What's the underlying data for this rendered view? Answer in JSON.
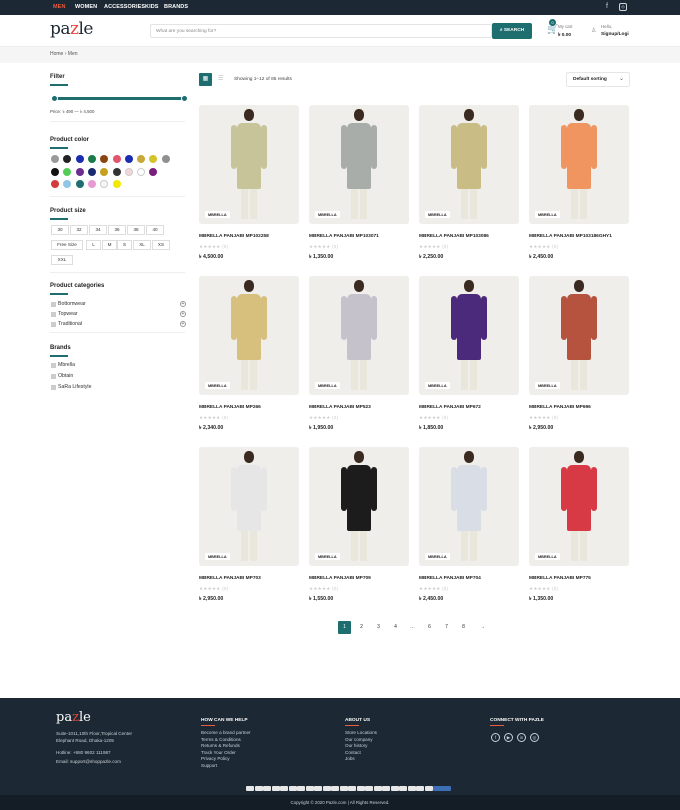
{
  "topbar": {
    "nav": [
      "MEN",
      "WOMEN",
      "ACCESSORIES",
      "KIDS",
      "BRANDS"
    ],
    "active": "MEN"
  },
  "header": {
    "logo_text": "pazle",
    "search_placeholder": "What are you searching for?",
    "search_button": "SEARCH",
    "cart_count": "0",
    "cart_label": "My cart",
    "cart_total": "৳ 0.00",
    "account_greeting": "Hello,",
    "account_link": "Signup/Logi"
  },
  "breadcrumb": {
    "home": "Home",
    "sep": "›",
    "current": "Men"
  },
  "filter": {
    "title": "Filter",
    "price_text": "Price: ৳ 490 — ৳ 4,500",
    "price_min_fraction": 0.0,
    "price_max_fraction": 1.0
  },
  "colors": {
    "title": "Product color",
    "swatches": [
      "#9a9a9a",
      "#222222",
      "#1a2db0",
      "#1a7a4a",
      "#8b4513",
      "#e2556e",
      "#1a2db0",
      "#c8a83a",
      "#d4c32a",
      "#8f8f8f",
      "#111111",
      "#55cc55",
      "#6b2d8f",
      "#1a2a6e",
      "#c6a020",
      "#333333",
      "#f3d6d6",
      "#ffffff",
      "#7a1f7a",
      "#d23c3c",
      "#8fc6e8",
      "#1e6d6f",
      "#e89ad0",
      "#f5f5f5",
      "#f2e800"
    ]
  },
  "sizes": {
    "title": "Product size",
    "items": [
      "30",
      "32",
      "34",
      "36",
      "38",
      "40",
      "Free Size",
      "L",
      "M",
      "S",
      "XL",
      "XS",
      "XXL"
    ]
  },
  "categories": {
    "title": "Product categories",
    "items": [
      "Bottomwear",
      "Topwear",
      "Traditional"
    ]
  },
  "brands": {
    "title": "Brands",
    "items": [
      "Mbrella",
      "Obtain",
      "SaRa Lifestyle"
    ]
  },
  "toolbar": {
    "result_text": "Showing 1–12 of 85 results",
    "sort_label": "Default sorting"
  },
  "products": [
    {
      "name": "MBRELLA PANJABI MP102258",
      "price": "৳ 4,500.00",
      "reviews": "(0)",
      "brand": "MBRELLA",
      "color": "#c8c49a"
    },
    {
      "name": "MBRELLA PANJABI MP103071",
      "price": "৳ 1,350.00",
      "reviews": "(0)",
      "brand": "MBRELLA",
      "color": "#a8adaa"
    },
    {
      "name": "MBRELLA PANJABI MP103086",
      "price": "৳ 2,250.00",
      "reviews": "(0)",
      "brand": "MBRELLA",
      "color": "#c9bd85"
    },
    {
      "name": "MBRELLA PANJABI MP103186GHY1",
      "price": "৳ 2,450.00",
      "reviews": "(0)",
      "brand": "MBRELLA",
      "color": "#f0955f"
    },
    {
      "name": "MBRELLA PANJABI MP266",
      "price": "৳ 2,340.00",
      "reviews": "(0)",
      "brand": "MBRELLA",
      "color": "#d7c07e"
    },
    {
      "name": "MBRELLA PANJABI MP523",
      "price": "৳ 1,950.00",
      "reviews": "(0)",
      "brand": "MBRELLA",
      "color": "#c5c2cc"
    },
    {
      "name": "MBRELLA PANJABI MP672",
      "price": "৳ 1,850.00",
      "reviews": "(0)",
      "brand": "MBRELLA",
      "color": "#4b2a7c"
    },
    {
      "name": "MBRELLA PANJABI MP696",
      "price": "৳ 2,950.00",
      "reviews": "(0)",
      "brand": "MBRELLA",
      "color": "#b5533f"
    },
    {
      "name": "MBRELLA PANJABI MP703",
      "price": "৳ 2,950.00",
      "reviews": "(0)",
      "brand": "MBRELLA",
      "color": "#e6e6e6"
    },
    {
      "name": "MBRELLA PANJABI MP709",
      "price": "৳ 1,550.00",
      "reviews": "(0)",
      "brand": "MBRELLA",
      "color": "#1c1c1c"
    },
    {
      "name": "MBRELLA PANJABI MP704",
      "price": "৳ 2,450.00",
      "reviews": "(0)",
      "brand": "MBRELLA",
      "color": "#d9dde5"
    },
    {
      "name": "MBRELLA PANJABI MP775",
      "price": "৳ 1,350.00",
      "reviews": "(0)",
      "brand": "MBRELLA",
      "color": "#d83a45"
    }
  ],
  "pagination": [
    "1",
    "2",
    "3",
    "4",
    "…",
    "6",
    "7",
    "8",
    "→"
  ],
  "footer": {
    "logo_text": "pazle",
    "address_lines": [
      "Suite-1011,10th Floor,Tropical Center",
      "Elephant Road, Dhaka-1205"
    ],
    "hotline": "Hotline: +880 9602 111987",
    "email": "Email: support@shoppazle.com",
    "help_title": "HOW CAN WE HELP",
    "help_links": [
      "Become a brand partner",
      "Terms & Conditions",
      "Returns & Refunds",
      "Track Your Order",
      "Privacy Policy",
      "Support"
    ],
    "about_title": "ABOUT US",
    "about_links": [
      "Store Locations",
      "Our company",
      "Our history",
      "Contact",
      "Jobs"
    ],
    "connect_title": "CONNECT WITH PAZLE",
    "copyright": "Copyright © 2020 Pazle.com | All Rights Reserved."
  },
  "accent_color": "#1e6d6f"
}
